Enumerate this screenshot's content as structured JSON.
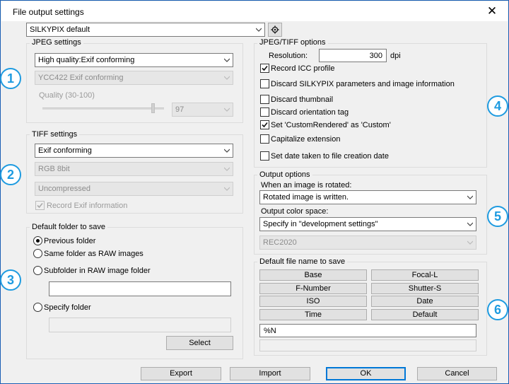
{
  "window": {
    "title": "File output settings",
    "close_glyph": "✕"
  },
  "preset": {
    "value": "SILKYPIX default",
    "gear_icon": "gear-icon"
  },
  "jpeg": {
    "group_label": "JPEG settings",
    "quality_mode": "High quality:Exif conforming",
    "color_mode": "YCC422 Exif conforming",
    "quality_label": "Quality (30-100)",
    "quality_value": "97"
  },
  "tiff": {
    "group_label": "TIFF settings",
    "format": "Exif conforming",
    "bit_depth": "RGB 8bit",
    "compression": "Uncompressed",
    "record_exif_label": "Record Exif information"
  },
  "folder": {
    "group_label": "Default folder to save",
    "options": [
      {
        "label": "Previous folder",
        "selected": true
      },
      {
        "label": "Same folder as RAW images",
        "selected": false
      },
      {
        "label": "Subfolder in RAW image folder",
        "selected": false
      },
      {
        "label": "Specify folder",
        "selected": false
      }
    ],
    "subfolder_value": "",
    "specify_value": "",
    "select_button": "Select"
  },
  "jpegtiff": {
    "group_label": "JPEG/TIFF options",
    "resolution_label": "Resolution:",
    "resolution_value": "300",
    "resolution_unit": "dpi",
    "checks": [
      {
        "label": "Record ICC profile",
        "checked": true
      },
      {
        "label": "Discard SILKYPIX parameters and image information",
        "checked": false
      },
      {
        "label": "Discard thumbnail",
        "checked": false
      },
      {
        "label": "Discard orientation tag",
        "checked": false
      },
      {
        "label": "Set 'CustomRendered' as 'Custom'",
        "checked": true
      },
      {
        "label": "Capitalize extension",
        "checked": false
      },
      {
        "label": "Set date taken to file creation date",
        "checked": false
      }
    ]
  },
  "output": {
    "group_label": "Output options",
    "rotated_label": "When an image is rotated:",
    "rotated_value": "Rotated image is written.",
    "colorspace_label": "Output color space:",
    "colorspace_value": "Specify in \"development settings\"",
    "colorspace_sub": "REC2020"
  },
  "filename": {
    "group_label": "Default file name to save",
    "buttons": [
      "Base",
      "Focal-L",
      "F-Number",
      "Shutter-S",
      "ISO",
      "Date",
      "Time",
      "Default"
    ],
    "pattern_value": "%N",
    "preview_value": ""
  },
  "badges": [
    "1",
    "2",
    "3",
    "4",
    "5",
    "6"
  ],
  "footer": {
    "export": "Export",
    "import": "Import",
    "ok": "OK",
    "cancel": "Cancel"
  },
  "colors": {
    "accent": "#1e9be0",
    "focus_border": "#0078d7",
    "window_bg": "#f0f0f0"
  }
}
